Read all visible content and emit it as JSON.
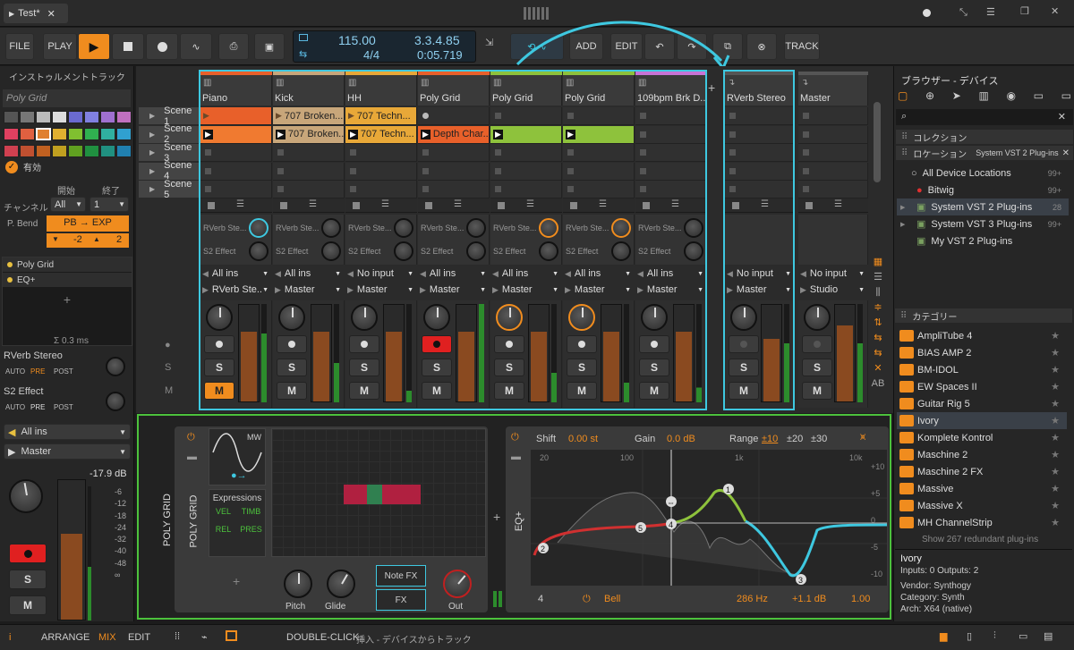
{
  "title_bar": {
    "tab_label": "Test",
    "tab_modified": "*"
  },
  "toolbar": {
    "file": "FILE",
    "play_label": "PLAY",
    "tempo": "115.00",
    "time_sig": "4/4",
    "position": "3.3.4.85",
    "time": "0:05.719",
    "add": "ADD",
    "edit": "EDIT",
    "track": "TRACK"
  },
  "inspector": {
    "header": "インストゥルメントトラック",
    "device_name": "Poly Grid",
    "active_label": "有効",
    "start_label": "開始",
    "end_label": "終了",
    "channel_label": "チャンネル",
    "channel_value": "All",
    "end_value": "1",
    "pbend_label": "P. Bend",
    "pbend_value": "PB → EXP",
    "pb_down": "-2",
    "pb_up": "2",
    "devices": [
      "Poly Grid",
      "EQ+"
    ],
    "latency": "Σ 0.3 ms",
    "sends": [
      {
        "name": "RVerb Stereo",
        "modes": [
          "AUTO",
          "PRE",
          "POST"
        ]
      },
      {
        "name": "S2 Effect",
        "modes": [
          "AUTO",
          "PRE",
          "POST"
        ]
      }
    ],
    "input": "All ins",
    "output": "Master",
    "db": "-17.9 dB",
    "scale": [
      "-6",
      "-12",
      "-18",
      "-24",
      "-32",
      "-40",
      "-48",
      "∞"
    ],
    "s": "S",
    "m": "M"
  },
  "scenes": [
    "Scene 1",
    "Scene 2",
    "Scene 3",
    "Scene 4",
    "Scene 5"
  ],
  "tracks": [
    {
      "name": "Piano",
      "color": "#e8602a",
      "clips": [
        "",
        "",
        ""
      ],
      "send1": "RVerb Ste...",
      "send2": "S2 Effect",
      "input": "All ins",
      "output": "RVerb Ste...",
      "m_active": true
    },
    {
      "name": "Kick",
      "color": "#c8a67a",
      "clips": [
        "707 Broken...",
        "707 Broken..."
      ],
      "send1": "RVerb Ste...",
      "send2": "S2 Effect",
      "input": "All ins",
      "output": "Master"
    },
    {
      "name": "HH",
      "color": "#e8a838",
      "clips": [
        "707 Techn...",
        "707 Techn..."
      ],
      "send1": "RVerb Ste...",
      "send2": "S2 Effect",
      "input": "No input",
      "output": "Master"
    },
    {
      "name": "Poly Grid",
      "color": "#e8602a",
      "clips": [
        "",
        "Depth Char..."
      ],
      "send1": "RVerb Ste...",
      "send2": "S2 Effect",
      "input": "All ins",
      "output": "Master"
    },
    {
      "name": "Poly Grid",
      "color": "#8ec23c",
      "clips": [
        "",
        ""
      ],
      "send1": "RVerb Ste...",
      "send2": "S2 Effect",
      "input": "All ins",
      "output": "Master"
    },
    {
      "name": "Poly Grid",
      "color": "#8ec23c",
      "clips": [
        "",
        ""
      ],
      "send1": "RVerb Ste...",
      "send2": "S2 Effect",
      "input": "All ins",
      "output": "Master"
    },
    {
      "name": "109bpm Brk D...",
      "color": "#c873d6",
      "clips": [
        "",
        ""
      ],
      "send1": "RVerb Ste...",
      "send2": "S2 Effect",
      "input": "All ins",
      "output": "Master"
    }
  ],
  "fx_tracks": [
    {
      "name": "RVerb Stereo",
      "input": "No input",
      "output": "Master"
    },
    {
      "name": "Master",
      "input": "No input",
      "output": "Studio"
    }
  ],
  "mixer_buttons": {
    "s": "S",
    "m": "M"
  },
  "device": {
    "poly_grid_label": "POLY GRID",
    "poly_grid_vert": "POLY GRID",
    "mw": "MW",
    "expressions": "Expressions",
    "expr": [
      "VEL",
      "TIMB",
      "REL",
      "PRES"
    ],
    "pitch": "Pitch",
    "glide": "Glide",
    "note_fx": "Note FX",
    "fx": "FX",
    "out": "Out",
    "eq_label": "EQ+",
    "shift_label": "Shift",
    "shift_value": "0.00 st",
    "gain_label": "Gain",
    "gain_value": "0.0 dB",
    "range_label": "Range",
    "range_opts": [
      "±10",
      "±20",
      "±30"
    ],
    "freq_ticks": [
      "20",
      "100",
      "1k",
      "10k"
    ],
    "db_ticks": [
      "+10",
      "+5",
      "0",
      "-5",
      "-10"
    ],
    "band_num": "4",
    "band_type": "Bell",
    "band_freq": "286 Hz",
    "band_gain": "+1.1 dB",
    "band_q": "1.00"
  },
  "browser": {
    "title": "ブラウザー - デバイス",
    "collection": "コレクション",
    "location": "ロケーション",
    "location_tag": "System VST 2 Plug-ins",
    "locations": [
      {
        "name": "All Device Locations",
        "count": "99+"
      },
      {
        "name": "Bitwig",
        "count": "99+"
      },
      {
        "name": "System VST 2 Plug-ins",
        "count": "28"
      },
      {
        "name": "System VST 3 Plug-ins",
        "count": "99+"
      },
      {
        "name": "My VST 2 Plug-ins",
        "count": ""
      }
    ],
    "category_label": "カテゴリー",
    "plugins": [
      "AmpliTube 4",
      "BIAS AMP 2",
      "BM-IDOL",
      "EW Spaces II",
      "Guitar Rig 5",
      "Ivory",
      "Komplete Kontrol",
      "Maschine 2",
      "Maschine 2 FX",
      "Massive",
      "Massive X",
      "MH ChannelStrip"
    ],
    "show_more": "Show 267 redundant plug-ins",
    "info": {
      "name": "Ivory",
      "io": "Inputs: 0   Outputs: 2",
      "vendor": "Vendor: Synthogy",
      "category": "Category: Synth",
      "arch": "Arch: X64 (native)"
    }
  },
  "bottom": {
    "arrange": "ARRANGE",
    "mix": "MIX",
    "edit": "EDIT",
    "hint_key": "DOUBLE-CLICK",
    "hint_text": "挿入 - デバイスからトラック"
  },
  "colors": {
    "accent": "#f08c1e",
    "highlight_cyan": "#3ec8e0",
    "highlight_green": "#4cc23c"
  }
}
